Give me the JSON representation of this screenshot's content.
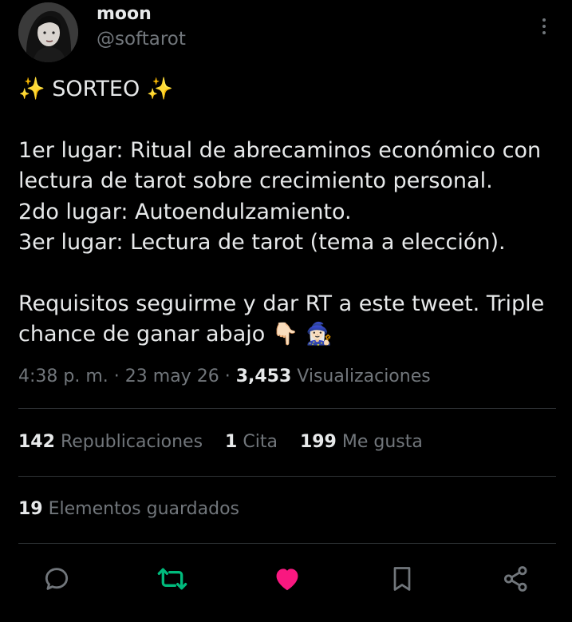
{
  "author": {
    "name": "moon",
    "handle": "@softarot"
  },
  "tweet": {
    "line1": "✨ SORTEO ✨",
    "line2": "1er lugar: Ritual de abrecaminos económico con",
    "line3": "lectura de tarot sobre crecimiento personal.",
    "line4": "2do lugar: Autoendulzamiento.",
    "line5": "3er lugar: Lectura de tarot (tema a elección).",
    "line6": "Requisitos seguirme y dar RT a este tweet. Triple",
    "line7": "chance de ganar abajo 👇🏻 🧙🏻‍♀️"
  },
  "meta": {
    "time": "4:38 p. m.",
    "sep1": "·",
    "date": "23 may 26",
    "sep2": "·",
    "views_count": "3,453",
    "views_label": "Visualizaciones"
  },
  "stats": {
    "retweets_count": "142",
    "retweets_label": "Republicaciones",
    "quotes_count": "1",
    "quotes_label": "Cita",
    "likes_count": "199",
    "likes_label": "Me gusta"
  },
  "bookmarks": {
    "count": "19",
    "label": "Elementos guardados"
  },
  "actions": {
    "reply_icon": "reply-icon",
    "retweet_icon": "retweet-icon",
    "like_icon": "heart-icon",
    "bookmark_icon": "bookmark-icon",
    "share_icon": "share-icon"
  },
  "colors": {
    "background": "#000000",
    "text": "#e7e9ea",
    "secondary": "#71767b",
    "divider": "#2f3336",
    "retweet": "#00ba7c",
    "like": "#f91880"
  }
}
